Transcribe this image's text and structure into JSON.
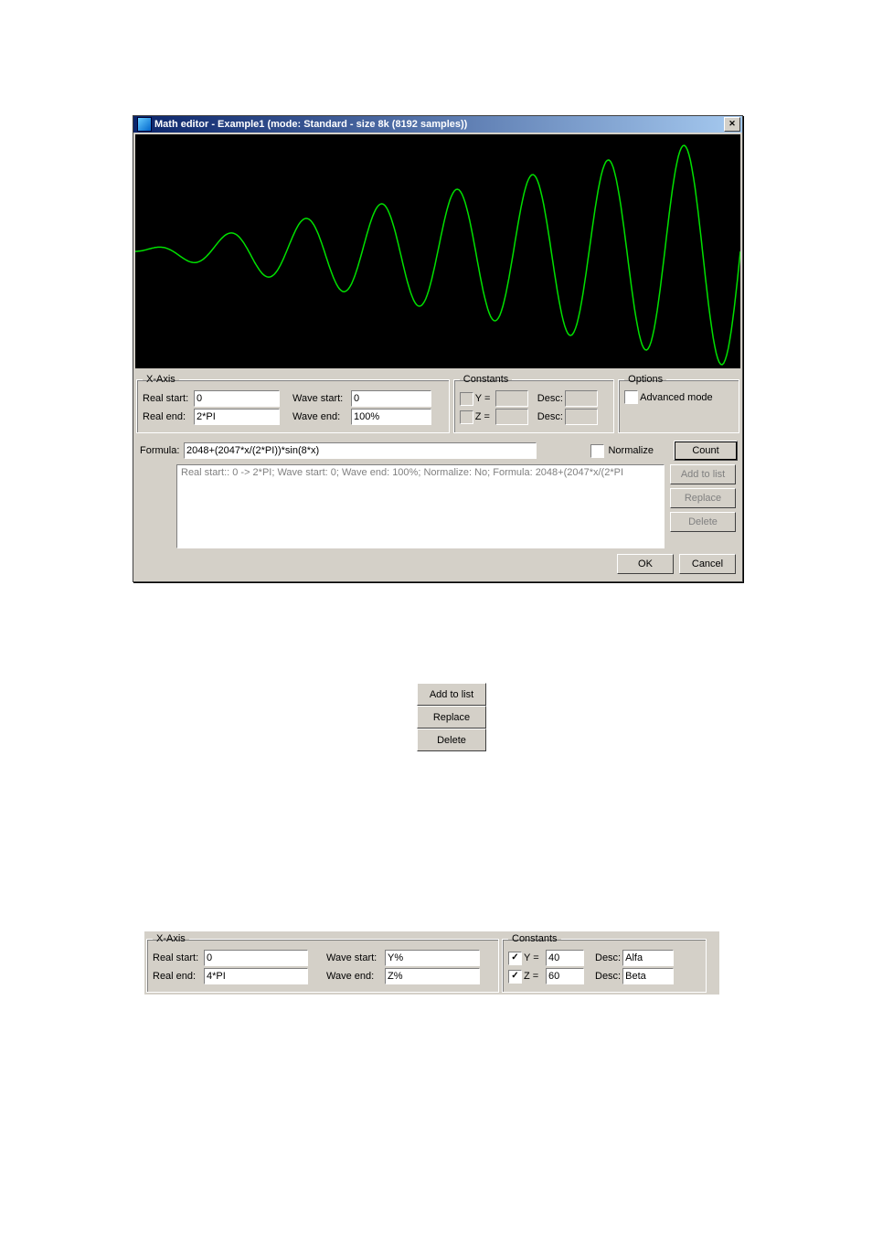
{
  "window": {
    "title": "Math editor - Example1 (mode: Standard - size 8k (8192 samples))"
  },
  "xaxis": {
    "legend": "X-Axis",
    "real_start_label": "Real start:",
    "real_start": "0",
    "real_end_label": "Real end:",
    "real_end": "2*PI",
    "wave_start_label": "Wave start:",
    "wave_start": "0",
    "wave_end_label": "Wave end:",
    "wave_end": "100%"
  },
  "constants": {
    "legend": "Constants",
    "y_label": "Y =",
    "y_value": "",
    "z_label": "Z =",
    "z_value": "",
    "desc_label": "Desc:"
  },
  "options": {
    "legend": "Options",
    "advanced_label": "Advanced mode"
  },
  "formula": {
    "label": "Formula:",
    "value": "2048+(2047*x/(2*PI))*sin(8*x)",
    "normalize_label": "Normalize"
  },
  "list": {
    "item0": "Real start:: 0 -> 2*PI; Wave start: 0; Wave end: 100%; Normalize: No; Formula: 2048+(2047*x/(2*PI"
  },
  "buttons": {
    "count": "Count",
    "add": "Add to list",
    "replace": "Replace",
    "delete": "Delete",
    "ok": "OK",
    "cancel": "Cancel"
  },
  "panel2": {
    "xaxis": {
      "legend": "X-Axis",
      "real_start_label": "Real start:",
      "real_start": "0",
      "real_end_label": "Real end:",
      "real_end": "4*PI",
      "wave_start_label": "Wave start:",
      "wave_start": "Y%",
      "wave_end_label": "Wave end:",
      "wave_end": "Z%"
    },
    "constants": {
      "legend": "Constants",
      "y_label": "Y =",
      "y_value": "40",
      "y_desc": "Alfa",
      "z_label": "Z =",
      "z_value": "60",
      "z_desc": "Beta",
      "desc_label": "Desc:"
    }
  },
  "chart_data": {
    "type": "line",
    "title": "",
    "xlabel": "",
    "ylabel": "",
    "description": "Sine wave with linearly increasing amplitude (envelope ramp)",
    "formula": "y = 2048 + (2047*x/(2*PI)) * sin(8*x)",
    "x_range": [
      0,
      6.2832
    ],
    "y_range": [
      1,
      4095
    ],
    "cycles": 8,
    "samples": 8192
  }
}
